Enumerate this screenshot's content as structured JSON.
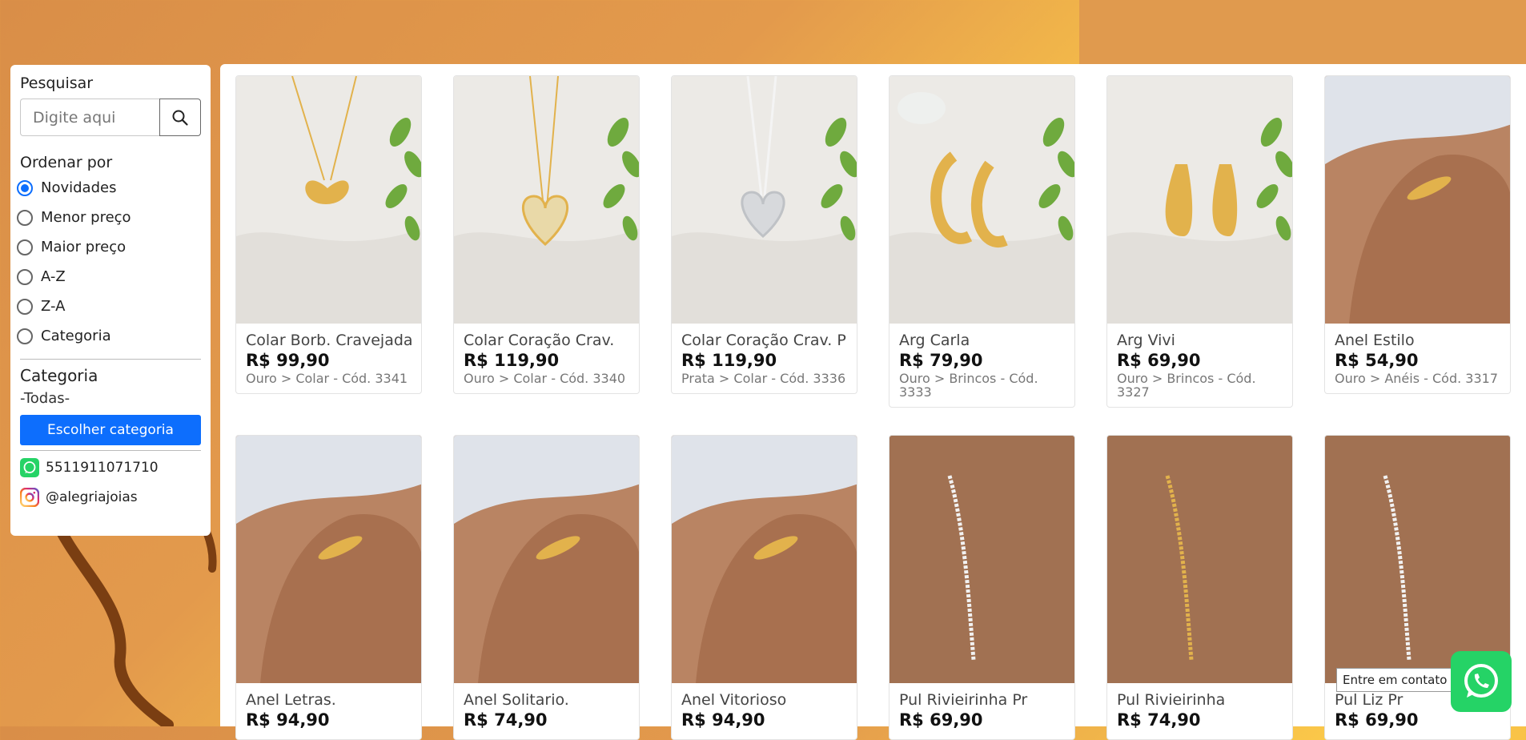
{
  "sidebar": {
    "search_label": "Pesquisar",
    "search_placeholder": "Digite aqui",
    "sort_label": "Ordenar por",
    "sort_options": [
      {
        "label": "Novidades",
        "checked": true
      },
      {
        "label": "Menor preço",
        "checked": false
      },
      {
        "label": "Maior preço",
        "checked": false
      },
      {
        "label": "A-Z",
        "checked": false
      },
      {
        "label": "Z-A",
        "checked": false
      },
      {
        "label": "Categoria",
        "checked": false
      }
    ],
    "category_label": "Categoria",
    "category_value": "-Todas-",
    "choose_category_label": "Escolher categoria",
    "whatsapp": "5511911071710",
    "instagram": "@alegriajoias"
  },
  "products": [
    {
      "name": "Colar Borb. Cravejada",
      "price": "R$ 99,90",
      "category": "Ouro > Colar - Cód. 3341",
      "image": "gold-butterfly-necklace"
    },
    {
      "name": "Colar Coração Crav.",
      "price": "R$ 119,90",
      "category": "Ouro > Colar - Cód. 3340",
      "image": "gold-heart-necklace"
    },
    {
      "name": "Colar Coração Crav. Pr",
      "price": "R$ 119,90",
      "category": "Prata > Colar - Cód. 3336",
      "image": "silver-heart-necklace"
    },
    {
      "name": "Arg Carla",
      "price": "R$ 79,90",
      "category": "Ouro > Brincos - Cód. 3333",
      "image": "gold-hoop-earrings"
    },
    {
      "name": "Arg Vivi",
      "price": "R$ 69,90",
      "category": "Ouro > Brincos - Cód. 3327",
      "image": "gold-drop-earrings"
    },
    {
      "name": "Anel Estilo",
      "price": "R$ 54,90",
      "category": "Ouro > Anéis - Cód. 3317",
      "image": "gold-ring-hand"
    },
    {
      "name": "Anel Letras.",
      "price": "R$ 94,90",
      "category": "",
      "image": "gold-letter-ring-hand"
    },
    {
      "name": "Anel Solitario.",
      "price": "R$ 74,90",
      "category": "",
      "image": "solitaire-ring-hand"
    },
    {
      "name": "Anel Vitorioso",
      "price": "R$ 94,90",
      "category": "",
      "image": "wide-gold-ring-hand"
    },
    {
      "name": "Pul Rivieirinha Pr",
      "price": "R$ 69,90",
      "category": "",
      "image": "silver-bracelet-wrist"
    },
    {
      "name": "Pul Rivieirinha",
      "price": "R$ 74,90",
      "category": "",
      "image": "gold-bracelet-wrist"
    },
    {
      "name": "Pul Liz Pr",
      "price": "R$ 69,90",
      "category": "",
      "image": "silver-heart-bracelet-wrist"
    }
  ],
  "contact_tooltip": "Entre em contato",
  "colors": {
    "accent": "#0d6efd",
    "whatsapp": "#25d366",
    "background": "#e39a4c"
  }
}
